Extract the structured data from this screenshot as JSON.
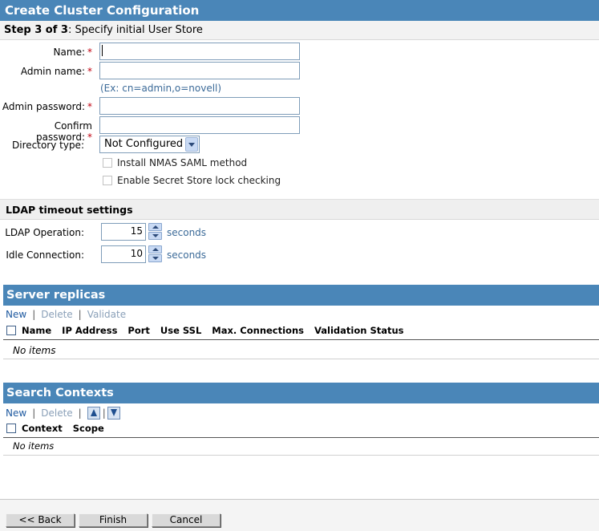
{
  "header_bar": {
    "title": "Create Cluster Configuration"
  },
  "step": {
    "label": "Step 3 of 3",
    "text": ": Specify initial User Store"
  },
  "form": {
    "fields": [
      {
        "label": "Name:",
        "required": "*",
        "value": ""
      },
      {
        "label": "Admin name:",
        "required": "*",
        "value": ""
      },
      {
        "label": "Admin password:",
        "required": "*",
        "value": ""
      },
      {
        "label": "Confirm password:",
        "required": "*",
        "value": ""
      }
    ],
    "admin_hint": "(Ex: cn=admin,o=novell)",
    "directory_type": {
      "label": "Directory type:",
      "selected": "Not Configured"
    },
    "checkboxes": [
      {
        "label": "Install NMAS SAML method",
        "checked": false
      },
      {
        "label": "Enable Secret Store lock checking",
        "checked": false
      }
    ]
  },
  "ldap": {
    "title": "LDAP timeout settings",
    "rows": [
      {
        "label": "LDAP Operation:",
        "value": "15",
        "unit": "seconds"
      },
      {
        "label": "Idle Connection:",
        "value": "10",
        "unit": "seconds"
      }
    ]
  },
  "replicas": {
    "title": "Server replicas",
    "toolbar": {
      "new": "New",
      "delete": "Delete",
      "validate": "Validate",
      "sep": "|"
    },
    "columns": [
      "Name",
      "IP Address",
      "Port",
      "Use SSL",
      "Max. Connections",
      "Validation Status"
    ],
    "empty_text": "No items"
  },
  "contexts": {
    "title": "Search Contexts",
    "toolbar": {
      "new": "New",
      "delete": "Delete",
      "sep": "|"
    },
    "columns": [
      "Context",
      "Scope"
    ],
    "empty_text": "No items"
  },
  "buttons": {
    "back": "<< Back",
    "finish": "Finish",
    "cancel": "Cancel"
  },
  "colors": {
    "header": "#4a86b8",
    "link": "#1f5aa0",
    "required": "#c0000f",
    "hint": "#3b6a98"
  }
}
